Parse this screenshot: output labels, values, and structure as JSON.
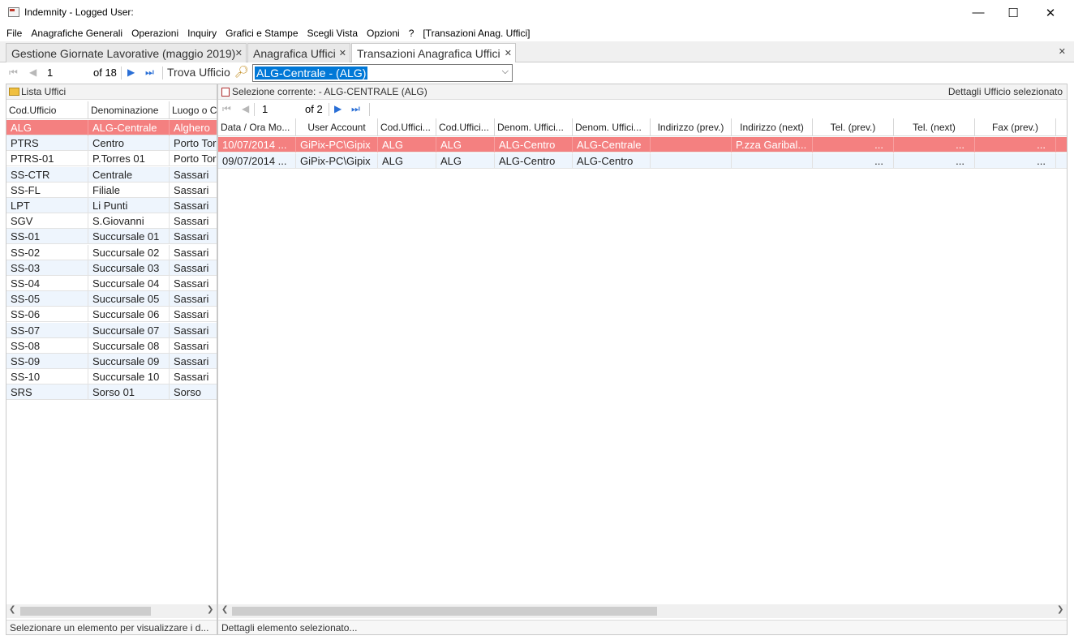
{
  "window": {
    "title": "Indemnity - Logged User:",
    "minimize": "—",
    "maximize": "☐",
    "close": "✕"
  },
  "menu": [
    "File",
    "Anagrafiche Generali",
    "Operazioni",
    "Inquiry",
    "Grafici e Stampe",
    "Scegli Vista",
    "Opzioni",
    "?",
    "[Transazioni Anag. Uffici]"
  ],
  "tabs": [
    {
      "label": "Gestione Giornate Lavorative (maggio 2019)",
      "close": "✕"
    },
    {
      "label": "Anagrafica Uffici",
      "close": "✕"
    },
    {
      "label": "Transazioni Anagrafica Uffici",
      "close": "✕"
    }
  ],
  "tabs_close_all": "✕",
  "navigator": {
    "page": "1",
    "of": "of 18",
    "find_label": "Trova Ufficio",
    "find_value": "ALG-Centrale - (ALG)"
  },
  "left": {
    "header": "Lista Uffici",
    "columns": [
      "Cod.Ufficio",
      "Denominazione",
      "Luogo o C"
    ],
    "rows": [
      [
        "ALG",
        "ALG-Centrale",
        "Alghero"
      ],
      [
        "PTRS",
        "Centro",
        "Porto Tor"
      ],
      [
        "PTRS-01",
        "P.Torres 01",
        "Porto Tor"
      ],
      [
        "SS-CTR",
        "Centrale",
        "Sassari"
      ],
      [
        "SS-FL",
        "Filiale",
        "Sassari"
      ],
      [
        "LPT",
        "Li Punti",
        "Sassari"
      ],
      [
        "SGV",
        "S.Giovanni",
        "Sassari"
      ],
      [
        "SS-01",
        "Succursale 01",
        "Sassari"
      ],
      [
        "SS-02",
        "Succursale 02",
        "Sassari"
      ],
      [
        "SS-03",
        "Succursale 03",
        "Sassari"
      ],
      [
        "SS-04",
        "Succursale 04",
        "Sassari"
      ],
      [
        "SS-05",
        "Succursale 05",
        "Sassari"
      ],
      [
        "SS-06",
        "Succursale 06",
        "Sassari"
      ],
      [
        "SS-07",
        "Succursale 07",
        "Sassari"
      ],
      [
        "SS-08",
        "Succursale 08",
        "Sassari"
      ],
      [
        "SS-09",
        "Succursale 09",
        "Sassari"
      ],
      [
        "SS-10",
        "Succursale 10",
        "Sassari"
      ],
      [
        "SRS",
        "Sorso 01",
        "Sorso"
      ]
    ],
    "status": "Selezionare un elemento per visualizzare i d..."
  },
  "right": {
    "header": "Selezione corrente:  - ALG-CENTRALE  (ALG)",
    "header_right": "Dettagli Ufficio selezionato",
    "page": "1",
    "of": "of 2",
    "columns": [
      "Data / Ora Mo...",
      "User Account",
      "Cod.Uffici...",
      "Cod.Uffici...",
      "Denom. Uffici...",
      "Denom. Uffici...",
      "Indirizzo (prev.)",
      "Indirizzo (next)",
      "Tel. (prev.)",
      "Tel. (next)",
      "Fax (prev.)"
    ],
    "rows": [
      [
        "10/07/2014 ...",
        "GiPix-PC\\Gipix",
        "ALG",
        "ALG",
        "ALG-Centro",
        "ALG-Centrale",
        "",
        "P.zza Garibal...",
        "...",
        "...",
        "..."
      ],
      [
        "09/07/2014 ...",
        "GiPix-PC\\Gipix",
        "ALG",
        "ALG",
        "ALG-Centro",
        "ALG-Centro",
        "",
        "",
        "...",
        "...",
        "..."
      ]
    ],
    "status": "Dettagli elemento selezionato..."
  },
  "colors": {
    "selected_row": "#f48080",
    "alt_row": "#eef5fd",
    "nav_icon": "#2a6fd6",
    "combo_highlight": "#0078d7"
  }
}
